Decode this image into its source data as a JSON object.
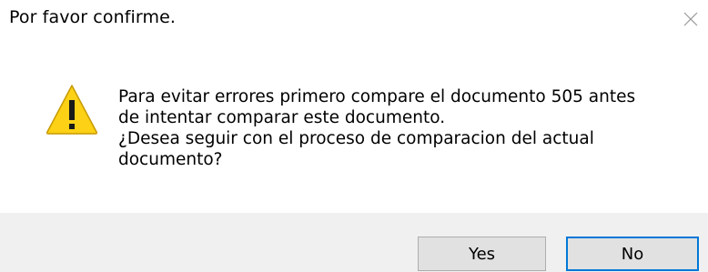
{
  "dialog": {
    "title": "Por favor confirme.",
    "close_icon": "close-icon",
    "warning_icon": "warning-icon",
    "message_lines": [
      "Para evitar errores primero compare el documento 505 antes",
      "de intentar comparar este documento.",
      "¿Desea seguir con el proceso de comparacion del actual",
      "documento?"
    ],
    "buttons": {
      "yes_label": "Yes",
      "no_label": "No"
    }
  },
  "colors": {
    "footer_background": "#f0f0f0",
    "button_background": "#e1e1e1",
    "button_border": "#adadad",
    "focus_border": "#0078d7",
    "warning_fill": "#fcd116",
    "warning_outline": "#c79a00"
  }
}
